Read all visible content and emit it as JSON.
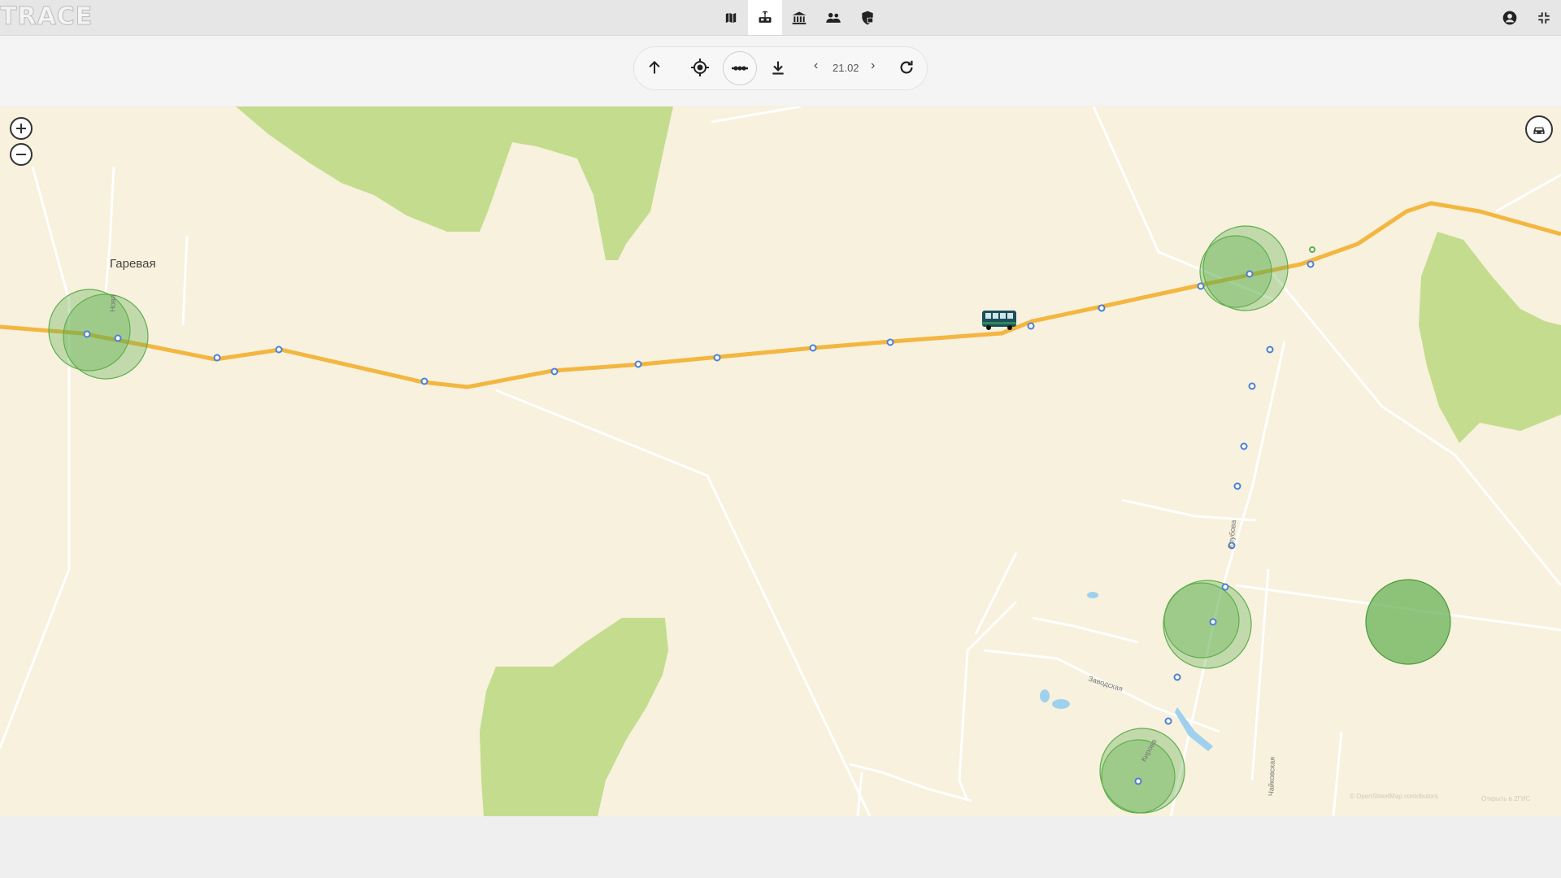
{
  "app": {
    "logo_text": "TRACE"
  },
  "nav": {
    "items": [
      {
        "name": "map",
        "active": false
      },
      {
        "name": "vehicle",
        "active": true
      },
      {
        "name": "organization",
        "active": false
      },
      {
        "name": "users",
        "active": false
      },
      {
        "name": "security",
        "active": false
      }
    ]
  },
  "topright": {
    "profile": "account-icon",
    "exit_fullscreen": "exit-fullscreen-icon"
  },
  "toolbar": {
    "date": "21.02",
    "prev": "‹",
    "next": "›"
  },
  "map": {
    "place_label": "Гаревая",
    "street_labels": [
      "Заводская",
      "Кирова",
      "Чайковская",
      "Клубова",
      "Нова"
    ],
    "attribution": "© OpenStreetMap contributors",
    "open_link": "Открыть в 2ГИС",
    "colors": {
      "background": "#f7f1dd",
      "forest": "#c4dc8e",
      "route": "#f3b640",
      "geofence": "#5fae4e",
      "road": "#ffffff",
      "water": "#9fd1ee"
    }
  }
}
